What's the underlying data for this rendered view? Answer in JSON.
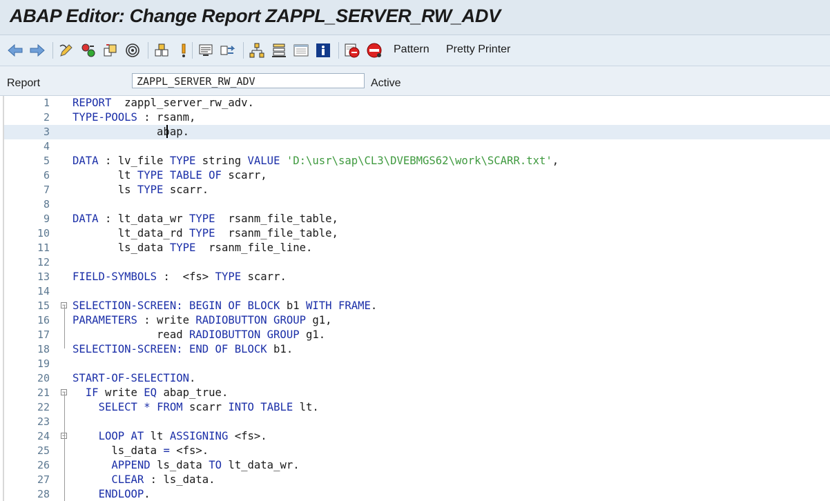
{
  "window": {
    "title": "ABAP Editor: Change Report ZAPPL_SERVER_RW_ADV"
  },
  "toolbar": {
    "icons": [
      {
        "name": "back-arrow-icon",
        "glyph": "⇦"
      },
      {
        "name": "forward-arrow-icon",
        "glyph": "⇨"
      },
      {
        "name": "display-change-icon",
        "glyph": "✎"
      },
      {
        "name": "active-inactive-icon",
        "glyph": "⚙"
      },
      {
        "name": "other-object-icon",
        "glyph": "⧉"
      },
      {
        "name": "check-icon",
        "glyph": "◎"
      },
      {
        "name": "activate-icon",
        "glyph": "⚒"
      },
      {
        "name": "test-icon",
        "glyph": "!"
      },
      {
        "name": "where-used-icon",
        "glyph": "▤"
      },
      {
        "name": "navigation-icon",
        "glyph": "⇋"
      },
      {
        "name": "object-list-icon",
        "glyph": "♖"
      },
      {
        "name": "navigation-window-icon",
        "glyph": "☰"
      },
      {
        "name": "fullscreen-icon",
        "glyph": "▭"
      },
      {
        "name": "info-icon",
        "glyph": "i"
      },
      {
        "name": "set-breakpoint-icon",
        "glyph": "⛔"
      },
      {
        "name": "external-breakpoint-icon",
        "glyph": "⛔"
      }
    ],
    "pattern_label": "Pattern",
    "pretty_printer_label": "Pretty Printer"
  },
  "header": {
    "report_label": "Report",
    "report_name": "ZAPPL_SERVER_RW_ADV",
    "status": "Active"
  },
  "editor": {
    "current_line": 3,
    "lines": [
      {
        "n": "1",
        "tokens": [
          [
            "kw",
            "REPORT"
          ],
          [
            "",
            "  zappl_server_rw_adv."
          ]
        ]
      },
      {
        "n": "2",
        "tokens": [
          [
            "kw",
            "TYPE-POOLS"
          ],
          [
            "",
            " : rsanm,"
          ]
        ]
      },
      {
        "n": "3",
        "tokens": [
          [
            "",
            "             abap."
          ]
        ]
      },
      {
        "n": "4",
        "tokens": []
      },
      {
        "n": "5",
        "tokens": [
          [
            "kw",
            "DATA"
          ],
          [
            "",
            " : lv_file "
          ],
          [
            "kw",
            "TYPE"
          ],
          [
            "",
            " string "
          ],
          [
            "kw",
            "VALUE"
          ],
          [
            "",
            " "
          ],
          [
            "str",
            "'D:\\usr\\sap\\CL3\\DVEBMGS62\\work\\SCARR.txt'"
          ],
          [
            "",
            ","
          ]
        ]
      },
      {
        "n": "6",
        "tokens": [
          [
            "",
            "       lt "
          ],
          [
            "kw",
            "TYPE TABLE OF"
          ],
          [
            "",
            " scarr,"
          ]
        ]
      },
      {
        "n": "7",
        "tokens": [
          [
            "",
            "       ls "
          ],
          [
            "kw",
            "TYPE"
          ],
          [
            "",
            " scarr."
          ]
        ]
      },
      {
        "n": "8",
        "tokens": []
      },
      {
        "n": "9",
        "tokens": [
          [
            "kw",
            "DATA"
          ],
          [
            "",
            " : lt_data_wr "
          ],
          [
            "kw",
            "TYPE"
          ],
          [
            "",
            "  rsanm_file_table,"
          ]
        ]
      },
      {
        "n": "10",
        "tokens": [
          [
            "",
            "       lt_data_rd "
          ],
          [
            "kw",
            "TYPE"
          ],
          [
            "",
            "  rsanm_file_table,"
          ]
        ]
      },
      {
        "n": "11",
        "tokens": [
          [
            "",
            "       ls_data "
          ],
          [
            "kw",
            "TYPE"
          ],
          [
            "",
            "  rsanm_file_line."
          ]
        ]
      },
      {
        "n": "12",
        "tokens": []
      },
      {
        "n": "13",
        "tokens": [
          [
            "kw",
            "FIELD-SYMBOLS"
          ],
          [
            "",
            " :  <fs> "
          ],
          [
            "kw",
            "TYPE"
          ],
          [
            "",
            " scarr."
          ]
        ]
      },
      {
        "n": "14",
        "tokens": []
      },
      {
        "n": "15",
        "fold": "−",
        "tokens": [
          [
            "kw",
            "SELECTION-SCREEN: BEGIN OF BLOCK"
          ],
          [
            "",
            " b1 "
          ],
          [
            "kw",
            "WITH FRAME"
          ],
          [
            "",
            "."
          ]
        ]
      },
      {
        "n": "16",
        "tokens": [
          [
            "kw",
            "PARAMETERS"
          ],
          [
            "",
            " : write "
          ],
          [
            "kw",
            "RADIOBUTTON GROUP"
          ],
          [
            "",
            " g1,"
          ]
        ]
      },
      {
        "n": "17",
        "tokens": [
          [
            "",
            "             read "
          ],
          [
            "kw",
            "RADIOBUTTON GROUP"
          ],
          [
            "",
            " g1."
          ]
        ]
      },
      {
        "n": "18",
        "tokens": [
          [
            "kw",
            "SELECTION-SCREEN: END OF BLOCK"
          ],
          [
            "",
            " b1."
          ]
        ]
      },
      {
        "n": "19",
        "tokens": []
      },
      {
        "n": "20",
        "tokens": [
          [
            "kw",
            "START-OF-SELECTION"
          ],
          [
            "",
            "."
          ]
        ]
      },
      {
        "n": "21",
        "fold": "−",
        "tokens": [
          [
            "",
            "  "
          ],
          [
            "kw",
            "IF"
          ],
          [
            "",
            " write "
          ],
          [
            "kw",
            "EQ"
          ],
          [
            "",
            " abap_true."
          ]
        ]
      },
      {
        "n": "22",
        "tokens": [
          [
            "",
            "    "
          ],
          [
            "kw",
            "SELECT"
          ],
          [
            "",
            " "
          ],
          [
            "kw",
            "*"
          ],
          [
            "",
            " "
          ],
          [
            "kw",
            "FROM"
          ],
          [
            "",
            " scarr "
          ],
          [
            "kw",
            "INTO TABLE"
          ],
          [
            "",
            " lt."
          ]
        ]
      },
      {
        "n": "23",
        "tokens": []
      },
      {
        "n": "24",
        "fold": "−",
        "tokens": [
          [
            "",
            "    "
          ],
          [
            "kw",
            "LOOP AT"
          ],
          [
            "",
            " lt "
          ],
          [
            "kw",
            "ASSIGNING"
          ],
          [
            "",
            " <fs>."
          ]
        ]
      },
      {
        "n": "25",
        "tokens": [
          [
            "",
            "      ls_data "
          ],
          [
            "kw",
            "="
          ],
          [
            "",
            " <fs>."
          ]
        ]
      },
      {
        "n": "26",
        "tokens": [
          [
            "",
            "      "
          ],
          [
            "kw",
            "APPEND"
          ],
          [
            "",
            " ls_data "
          ],
          [
            "kw",
            "TO"
          ],
          [
            "",
            " lt_data_wr."
          ]
        ]
      },
      {
        "n": "27",
        "tokens": [
          [
            "",
            "      "
          ],
          [
            "kw",
            "CLEAR"
          ],
          [
            "",
            " : ls_data."
          ]
        ]
      },
      {
        "n": "28",
        "tokens": [
          [
            "",
            "    "
          ],
          [
            "kw",
            "ENDLOOP"
          ],
          [
            "",
            "."
          ]
        ]
      }
    ]
  },
  "colors": {
    "keyword": "#1b2fa8",
    "string": "#3f9a3f",
    "line_number": "#5c7891",
    "current_line_bg": "#e3ecf5"
  }
}
